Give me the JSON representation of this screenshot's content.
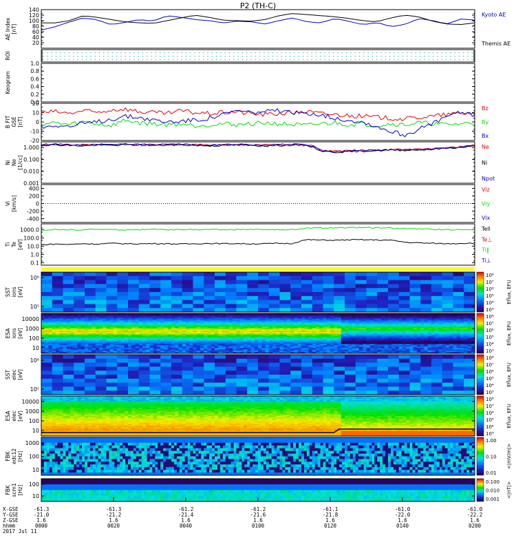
{
  "page": {
    "title": "P2 (TH-C)"
  },
  "colors": {
    "axis": "#000000",
    "red": "#e00000",
    "green": "#00dd00",
    "blue": "#0000cc",
    "black": "#000000",
    "cyan_dot": "#20b0b0",
    "yellow": "#ffff00"
  },
  "panels": [
    {
      "id": "ae",
      "type": "line",
      "ylabel": [
        "AE Index",
        "[nT]"
      ],
      "yticks": [
        "20",
        "40",
        "60",
        "80",
        "100",
        "120",
        "140"
      ],
      "ylim": [
        0,
        140
      ],
      "legend": [
        {
          "label": "Kyoto AE",
          "color": "#0000cc"
        },
        {
          "label": "Themis AE",
          "color": "#000000"
        }
      ],
      "series": [
        {
          "name": "Kyoto AE",
          "color": "#0000cc",
          "values": [
            66,
            78,
            95,
            110,
            103,
            85,
            94,
            104,
            98,
            118,
            112,
            104,
            100,
            92,
            98,
            96,
            88,
            100,
            110,
            96,
            92,
            108,
            98,
            85,
            94,
            78,
            86,
            108,
            100,
            88,
            106,
            102
          ]
        },
        {
          "name": "Themis AE",
          "color": "#000000",
          "values": [
            92,
            92,
            100,
            118,
            112,
            104,
            96,
            92,
            90,
            100,
            110,
            120,
            112,
            102,
            100,
            98,
            104,
            118,
            126,
            122,
            118,
            114,
            108,
            100,
            96,
            110,
            120,
            114,
            98,
            88,
            86,
            92
          ]
        }
      ]
    },
    {
      "id": "roi",
      "type": "dots",
      "ylabel": [
        "ROI"
      ],
      "yticks": []
    },
    {
      "id": "keogram",
      "type": "empty",
      "ylabel": [
        "Keogram"
      ],
      "yticks": [
        "0.0",
        "0.2",
        "0.4",
        "0.6",
        "0.8",
        "1.0"
      ],
      "ylim": [
        0,
        1
      ]
    },
    {
      "id": "bfield",
      "type": "line",
      "ylabel": [
        "B FIT",
        "GSE",
        "[nT]"
      ],
      "yticks": [
        "-20",
        "-10",
        "0",
        "10",
        "20"
      ],
      "ylim": [
        -20,
        20
      ],
      "legend": [
        {
          "label": "Bz",
          "color": "#e00000"
        },
        {
          "label": "By",
          "color": "#00dd00"
        },
        {
          "label": "Bx",
          "color": "#0000cc"
        }
      ],
      "series": [
        {
          "name": "Bz",
          "color": "#e00000",
          "values": [
            10,
            11,
            9,
            12,
            10,
            13,
            14,
            11,
            10,
            9,
            12,
            10,
            9,
            10,
            11,
            9,
            8,
            9,
            10,
            11,
            9,
            8,
            7,
            6,
            5,
            4,
            3,
            5,
            6,
            8,
            9,
            10
          ]
        },
        {
          "name": "By",
          "color": "#00dd00",
          "values": [
            -2,
            -1,
            -3,
            0,
            -2,
            -4,
            2,
            -1,
            -2,
            -3,
            -2,
            -4,
            -3,
            -2,
            -3,
            -2,
            -1,
            -2,
            -3,
            -4,
            -2,
            -1,
            -3,
            -2,
            -4,
            -2,
            -3,
            -1,
            -2,
            -3,
            -2,
            -1
          ]
        },
        {
          "name": "Bx",
          "color": "#0000cc",
          "values": [
            -6,
            -3,
            -5,
            -2,
            0,
            3,
            6,
            5,
            2,
            0,
            1,
            2,
            4,
            8,
            12,
            10,
            11,
            12,
            9,
            10,
            8,
            4,
            2,
            0,
            -5,
            -10,
            -14,
            -8,
            -2,
            6,
            10,
            8
          ]
        }
      ]
    },
    {
      "id": "density",
      "type": "line",
      "ylabel": [
        "Ni",
        "Ne",
        "[1/cc]"
      ],
      "yticks": [
        "0.001",
        "0.010",
        "0.100",
        "1.000"
      ],
      "log": true,
      "ylim": [
        0.001,
        3
      ],
      "legend": [
        {
          "label": "Ne",
          "color": "#e00000"
        },
        {
          "label": "Ni",
          "color": "#000000"
        },
        {
          "label": "Npot",
          "color": "#0000cc"
        }
      ],
      "series": [
        {
          "name": "Ne",
          "color": "#e00000",
          "values": [
            1.9,
            2.0,
            1.8,
            1.7,
            1.9,
            1.8,
            2.0,
            1.9,
            1.8,
            1.9,
            2.0,
            1.8,
            1.7,
            1.8,
            1.9,
            1.8,
            1.7,
            1.8,
            1.9,
            1.8,
            0.6,
            0.5,
            0.55,
            0.6,
            0.65,
            0.7,
            0.7,
            0.75,
            0.8,
            1.0,
            1.2,
            1.5
          ]
        },
        {
          "name": "Ni",
          "color": "#000000",
          "values": [
            1.6,
            1.7,
            1.5,
            1.4,
            1.6,
            1.5,
            1.7,
            1.6,
            1.5,
            1.6,
            1.7,
            1.5,
            1.4,
            1.5,
            1.6,
            1.5,
            1.4,
            1.5,
            1.6,
            1.5,
            0.5,
            0.4,
            0.45,
            0.5,
            0.55,
            0.6,
            0.6,
            0.65,
            0.7,
            0.9,
            1.0,
            1.3
          ]
        },
        {
          "name": "Npot",
          "color": "#0000cc",
          "values": [
            1.8,
            1.9,
            1.7,
            1.6,
            1.8,
            1.7,
            1.9,
            1.8,
            1.7,
            1.8,
            1.9,
            1.7,
            1.6,
            1.7,
            1.8,
            1.7,
            1.6,
            1.7,
            1.8,
            1.7,
            0.55,
            0.45,
            0.5,
            0.55,
            0.6,
            0.65,
            0.65,
            0.7,
            0.75,
            0.95,
            1.1,
            1.4
          ]
        }
      ]
    },
    {
      "id": "velocity",
      "type": "line",
      "ylabel": [
        "Vi",
        "[km/s]"
      ],
      "yticks": [
        "-400",
        "-200",
        "0",
        "200",
        "400"
      ],
      "ylim": [
        -500,
        500
      ],
      "legend": [
        {
          "label": "Viz",
          "color": "#e00000"
        },
        {
          "label": "Viy",
          "color": "#00dd00"
        },
        {
          "label": "Vix",
          "color": "#0000cc"
        }
      ],
      "zero_line": true
    },
    {
      "id": "temp",
      "type": "line",
      "ylabel": [
        "Ti",
        "Te",
        "[eV]"
      ],
      "yticks": [
        "0.1",
        "1.0",
        "10.0",
        "100.0",
        "1000.0"
      ],
      "log": true,
      "ylim": [
        0.05,
        5000
      ],
      "legend": [
        {
          "label": "Tell",
          "color": "#000000"
        },
        {
          "label": "Te⊥",
          "color": "#e00000"
        },
        {
          "label": "Ti‖",
          "color": "#00dd00"
        },
        {
          "label": "Ti⊥",
          "color": "#0000cc"
        }
      ],
      "series": [
        {
          "name": "Te",
          "color": "#00dd00",
          "values": [
            900,
            1000,
            950,
            1000,
            1100,
            1000,
            950,
            1000,
            1050,
            1000,
            950,
            1000,
            1050,
            1000,
            1000,
            1100,
            1000,
            950,
            1000,
            1500,
            1600,
            1700,
            1650,
            1800,
            1700,
            1600,
            1300,
            1200,
            1100,
            1000,
            1050,
            1000
          ]
        },
        {
          "name": "Ti",
          "color": "#000000",
          "values": [
            15,
            18,
            16,
            20,
            18,
            22,
            20,
            19,
            21,
            20,
            18,
            20,
            22,
            20,
            21,
            19,
            20,
            22,
            21,
            60,
            55,
            52,
            58,
            60,
            56,
            52,
            30,
            25,
            22,
            20,
            22,
            24
          ]
        }
      ]
    },
    {
      "id": "sst_i",
      "type": "spectrogram",
      "ylabel": [
        "SST",
        "ions",
        "[eV]"
      ],
      "yticks": [
        "10⁶",
        "10⁵"
      ],
      "cb_label": "Eflux, EFU",
      "cb_ticks": [
        "10⁸",
        "10⁷",
        "10⁶",
        "10⁵",
        "10⁴",
        "10³"
      ]
    },
    {
      "id": "esa_i",
      "type": "spectrogram",
      "ylabel": [
        "ESA",
        "ions",
        "[eV]"
      ],
      "yticks": [
        "10000",
        "1000",
        "100",
        "10"
      ],
      "cb_label": "Eflux, EFU",
      "cb_ticks": [
        "10⁸",
        "10⁷",
        "10⁶",
        "10⁵",
        "10⁴",
        "10³"
      ]
    },
    {
      "id": "sst_e",
      "type": "spectrogram",
      "ylabel": [
        "SST",
        "elec",
        "[eV]"
      ],
      "yticks": [
        "10⁶",
        "10⁵"
      ],
      "cb_label": "Eflux, EFU",
      "cb_ticks": [
        "10⁸",
        "10⁷",
        "10⁶",
        "10⁵",
        "10⁴",
        "10³"
      ]
    },
    {
      "id": "esa_e",
      "type": "spectrogram",
      "ylabel": [
        "ESA",
        "elec",
        "[eV]"
      ],
      "yticks": [
        "10000",
        "1000",
        "100",
        "10"
      ],
      "cb_label": "Eflux, EFU",
      "cb_ticks": [
        "10⁸",
        "10⁷",
        "10⁶",
        "10⁵",
        "10⁴",
        "10³"
      ]
    },
    {
      "id": "fbk_e",
      "type": "spectrogram",
      "ylabel": [
        "FBK",
        "edc12",
        "[Hz]"
      ],
      "yticks": [
        "1000",
        "100",
        "10"
      ],
      "cb_label": "<|mV/m|>",
      "cb_ticks": [
        "1.00",
        "0.10",
        "0.01"
      ]
    },
    {
      "id": "fbk_b",
      "type": "spectrogram",
      "ylabel": [
        "FBK",
        "scm1",
        "[Hz]"
      ],
      "yticks": [
        "100",
        "10"
      ],
      "cb_label": "<|nT|>",
      "cb_ticks": [
        "0.100",
        "0.010",
        "0.001"
      ]
    }
  ],
  "bottom_axis": {
    "row_labels": [
      "X-GSE",
      "Y-GSE",
      "Z-GSE",
      "hhmm",
      "2017 Jul 11"
    ],
    "columns": [
      [
        "-61.3",
        "-21.0",
        "1.6",
        "0000"
      ],
      [
        "-61.3",
        "-21.2",
        "1.6",
        "0020"
      ],
      [
        "-61.2",
        "-21.4",
        "1.6",
        "0040"
      ],
      [
        "-61.2",
        "-21.6",
        "1.6",
        "0100"
      ],
      [
        "-61.1",
        "-21.8",
        "1.6",
        "0120"
      ],
      [
        "-61.0",
        "-22.0",
        "1.6",
        "0140"
      ],
      [
        "-61.0",
        "-22.2",
        "1.6",
        "0200"
      ]
    ]
  },
  "chart_data": [
    {
      "type": "line",
      "title": "P2 (TH-C)",
      "ylabel": "AE Index [nT]",
      "ylim": [
        0,
        140
      ],
      "x_ticks": [
        "0000",
        "0020",
        "0040",
        "0100",
        "0120",
        "0140",
        "0200"
      ],
      "series": [
        {
          "name": "Kyoto AE"
        },
        {
          "name": "Themis AE"
        }
      ]
    },
    {
      "type": "line",
      "ylabel": "B FIT GSE [nT]",
      "ylim": [
        -20,
        20
      ],
      "series": [
        {
          "name": "Bz"
        },
        {
          "name": "By"
        },
        {
          "name": "Bx"
        }
      ]
    },
    {
      "type": "line",
      "ylabel": "Ni Ne [1/cc]",
      "log": true,
      "series": [
        {
          "name": "Ne"
        },
        {
          "name": "Ni"
        },
        {
          "name": "Npot"
        }
      ]
    },
    {
      "type": "line",
      "ylabel": "Vi [km/s]",
      "ylim": [
        -500,
        500
      ],
      "series": [
        {
          "name": "Viz"
        },
        {
          "name": "Viy"
        },
        {
          "name": "Vix"
        }
      ]
    },
    {
      "type": "line",
      "ylabel": "Ti Te [eV]",
      "log": true,
      "series": [
        {
          "name": "Tell"
        },
        {
          "name": "Te⊥"
        },
        {
          "name": "Ti‖"
        },
        {
          "name": "Ti⊥"
        }
      ]
    },
    {
      "type": "heatmap",
      "ylabel": "SST ions [eV]"
    },
    {
      "type": "heatmap",
      "ylabel": "ESA ions [eV]"
    },
    {
      "type": "heatmap",
      "ylabel": "SST elec [eV]"
    },
    {
      "type": "heatmap",
      "ylabel": "ESA elec [eV]"
    },
    {
      "type": "heatmap",
      "ylabel": "FBK edc12 [Hz]"
    },
    {
      "type": "heatmap",
      "ylabel": "FBK scm1 [Hz]"
    }
  ]
}
